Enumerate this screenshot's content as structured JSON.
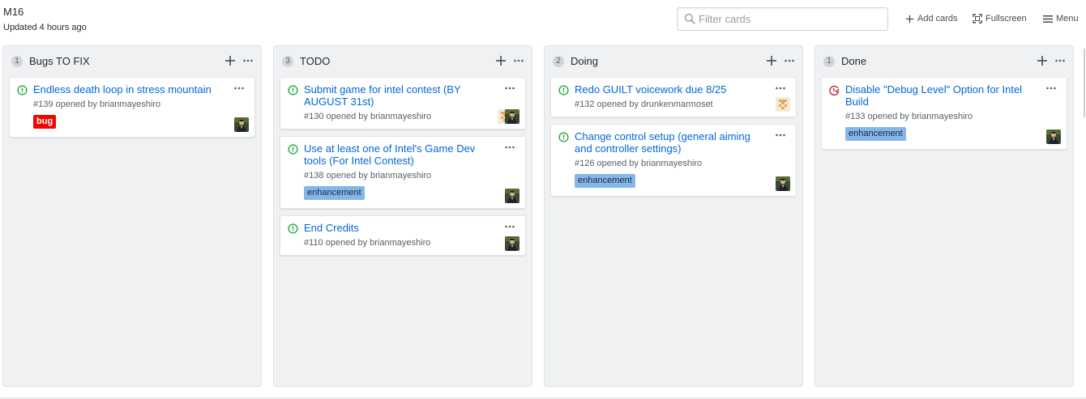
{
  "project": {
    "title": "M16",
    "updated": "Updated 4 hours ago"
  },
  "header": {
    "filter_placeholder": "Filter cards",
    "add_cards": "Add cards",
    "fullscreen": "Fullscreen",
    "menu": "Menu"
  },
  "colors": {
    "link": "#0366d6",
    "open_icon": "#28a745",
    "closed_icon": "#cb2431",
    "column_bg": "#eff1f3",
    "label_bug": "#ee0701",
    "label_enhancement": "#84b6eb"
  },
  "columns": [
    {
      "name": "Bugs TO FIX",
      "count": "1",
      "cards": [
        {
          "title": "Endless death loop in stress mountain",
          "meta": "#139 opened by brianmayeshiro",
          "label": "bug",
          "state": "open"
        }
      ]
    },
    {
      "name": "TODO",
      "count": "3",
      "cards": [
        {
          "title": "Submit game for intel contest (BY AUGUST 31st)",
          "meta": "#130 opened by brianmayeshiro",
          "state": "open"
        },
        {
          "title": "Use at least one of Intel's Game Dev tools (For Intel Contest)",
          "meta": "#138 opened by brianmayeshiro",
          "label": "enhancement",
          "state": "open"
        },
        {
          "title": "End Credits",
          "meta": "#110 opened by brianmayeshiro",
          "state": "open"
        }
      ]
    },
    {
      "name": "Doing",
      "count": "2",
      "cards": [
        {
          "title": "Redo GUILT voicework due 8/25",
          "meta": "#132 opened by drunkenmarmoset",
          "state": "open"
        },
        {
          "title": "Change control setup (general aiming and controller settings)",
          "meta": "#126 opened by brianmayeshiro",
          "label": "enhancement",
          "state": "open"
        }
      ]
    },
    {
      "name": "Done",
      "count": "1",
      "cards": [
        {
          "title": "Disable \"Debug Level\" Option for Intel Build",
          "meta": "#133 opened by brianmayeshiro",
          "label": "enhancement",
          "state": "closed"
        }
      ]
    }
  ]
}
